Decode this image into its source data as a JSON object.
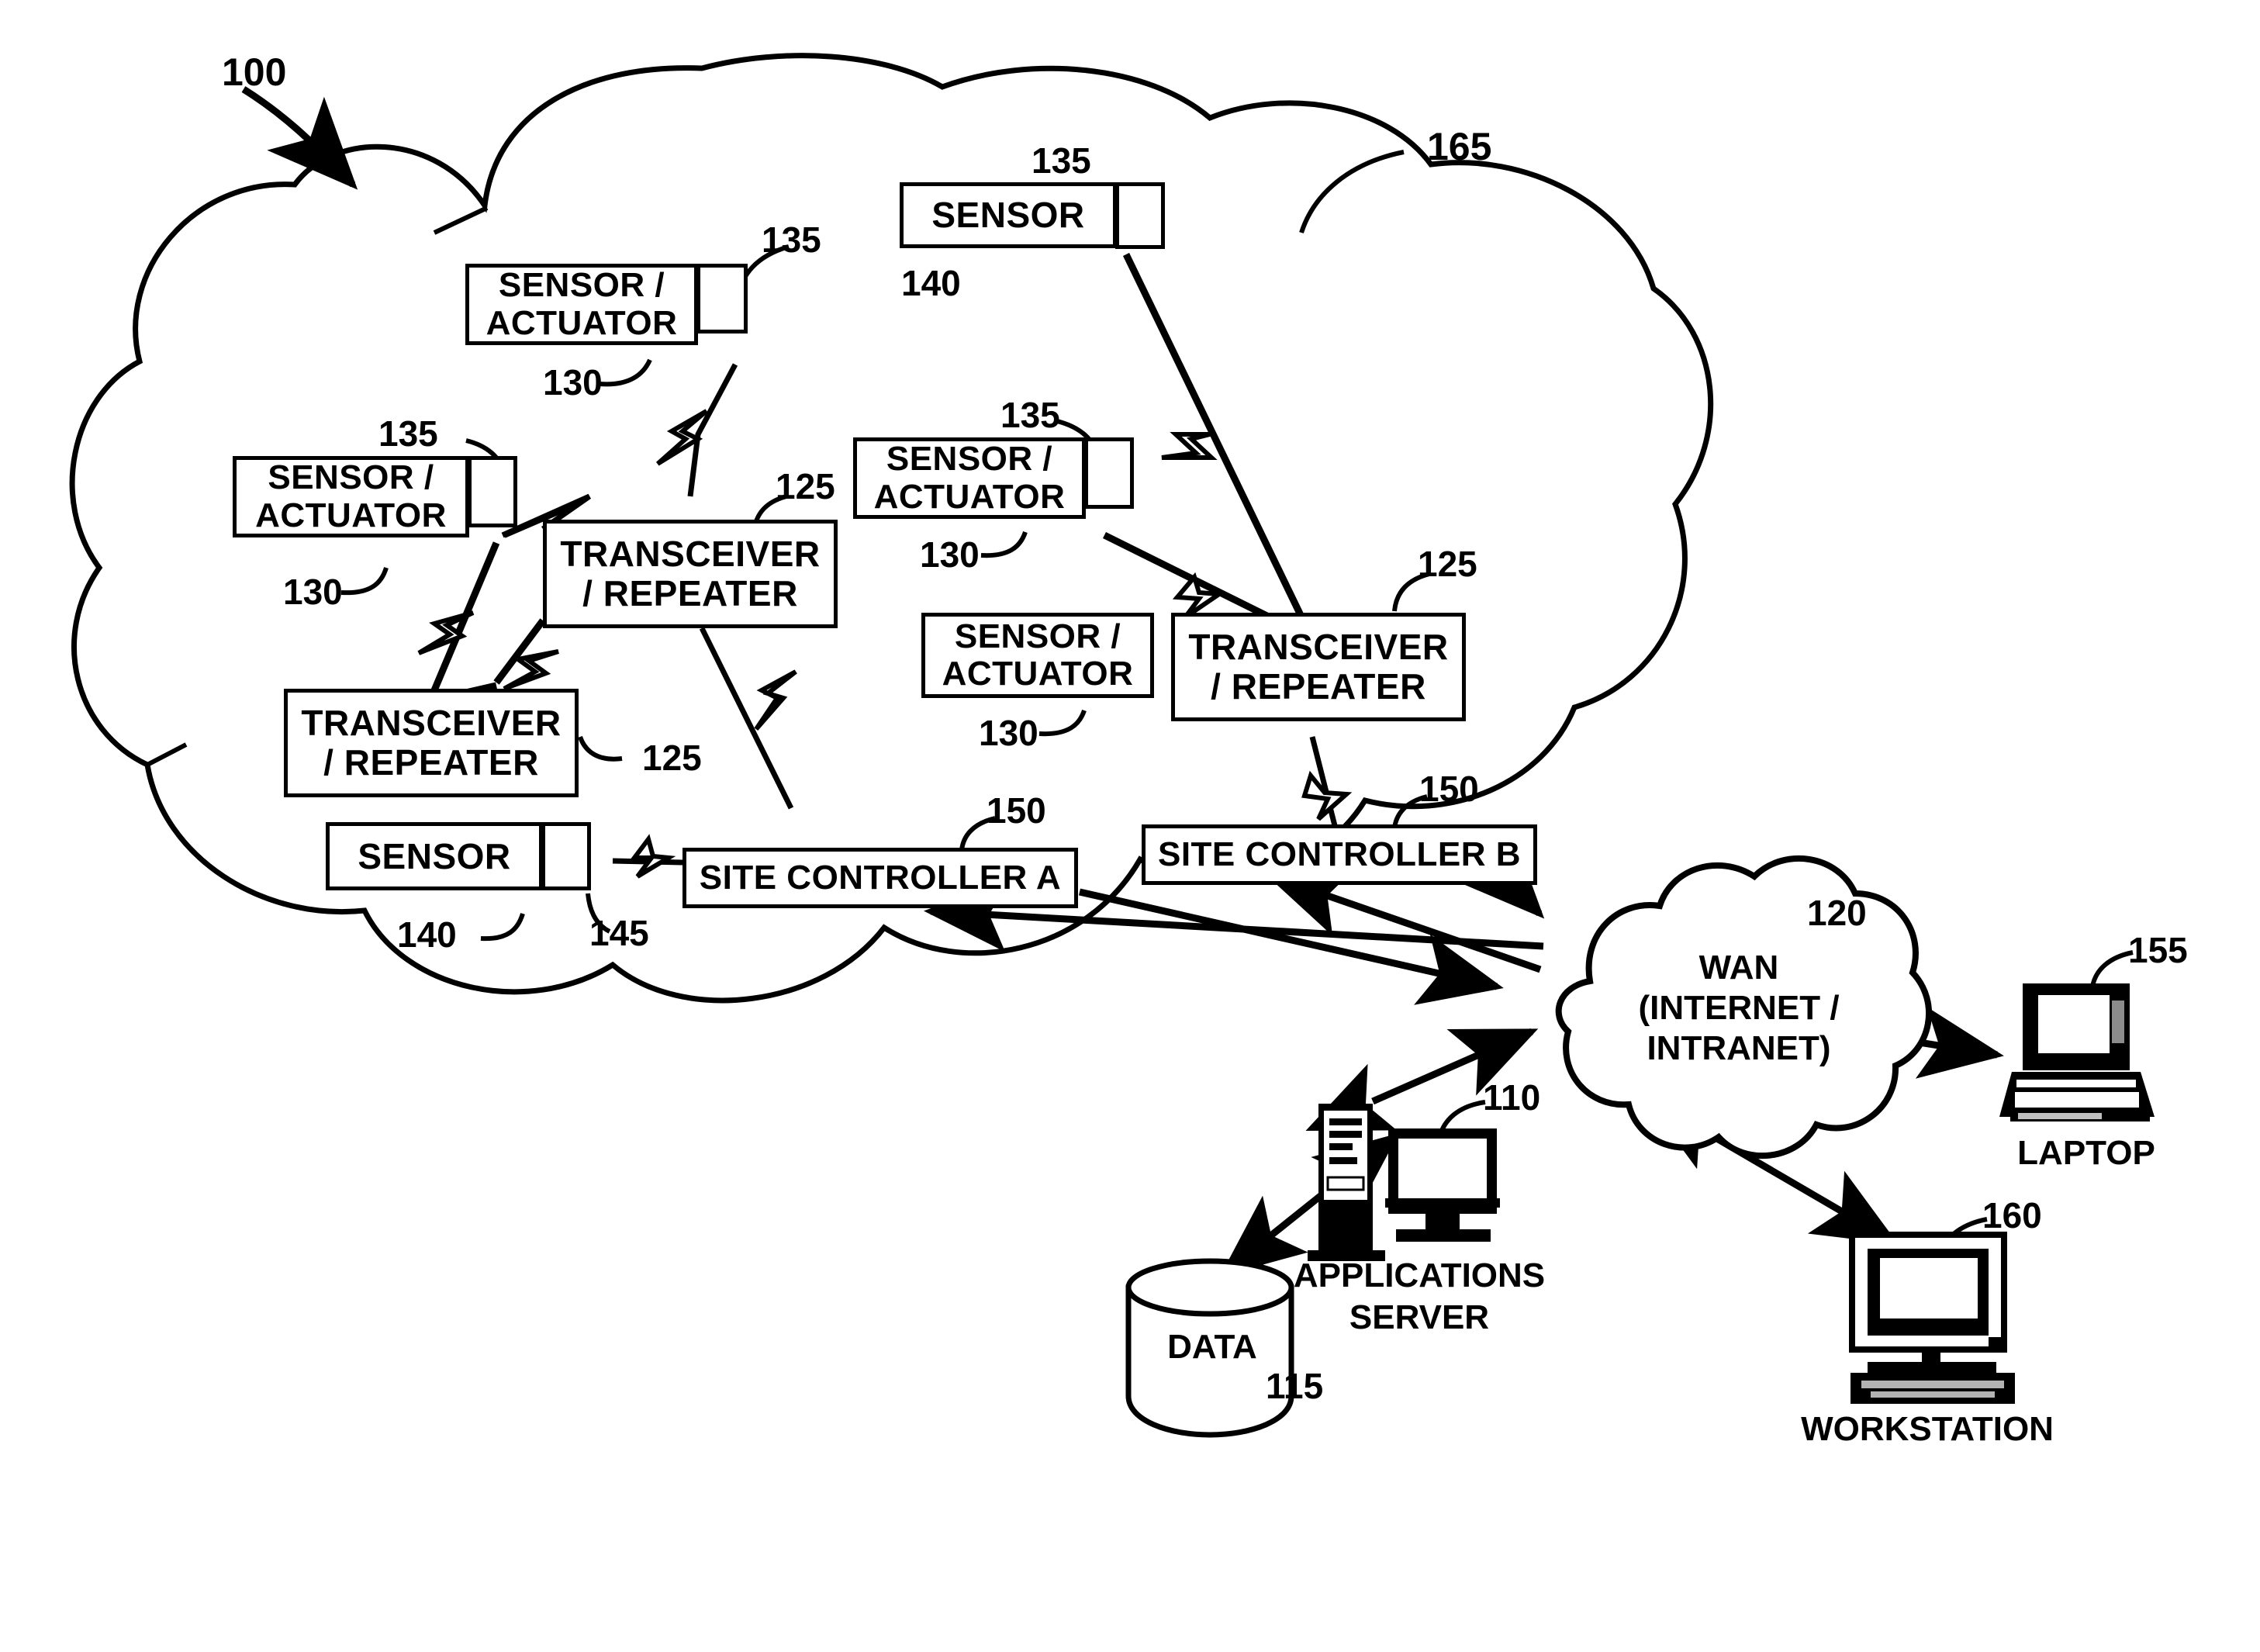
{
  "figure": {
    "type": "patent-network-diagram",
    "system_ref": "100",
    "site_cloud_ref": "165",
    "background": "#ffffff",
    "ink": "#000000"
  },
  "nodes": {
    "sensor_actuator_top": {
      "line1": "SENSOR /",
      "line2": "ACTUATOR",
      "ref_device": "130",
      "ref_antenna": "135"
    },
    "sensor_actuator_left": {
      "line1": "SENSOR /",
      "line2": "ACTUATOR",
      "ref_device": "130",
      "ref_antenna": "135"
    },
    "sensor_actuator_mid": {
      "line1": "SENSOR /",
      "line2": "ACTUATOR",
      "ref_device": "130",
      "ref_antenna": "135"
    },
    "sensor_actuator_lower_mid": {
      "line1": "SENSOR /",
      "line2": "ACTUATOR",
      "ref_device": "130"
    },
    "sensor_top": {
      "line1": "SENSOR",
      "ref_device": "140",
      "ref_antenna": "135"
    },
    "sensor_bottom": {
      "line1": "SENSOR",
      "ref_device": "140",
      "ref_module": "145"
    },
    "transceiver_left": {
      "line1": "TRANSCEIVER",
      "line2": "/ REPEATER",
      "ref": "125"
    },
    "transceiver_lower_left": {
      "line1": "TRANSCEIVER",
      "line2": "/ REPEATER",
      "ref": "125"
    },
    "transceiver_right": {
      "line1": "TRANSCEIVER",
      "line2": "/ REPEATER",
      "ref": "125"
    },
    "site_controller_a": {
      "label": "SITE CONTROLLER A",
      "ref": "150"
    },
    "site_controller_b": {
      "label": "SITE CONTROLLER B",
      "ref": "150"
    },
    "wan": {
      "line1": "WAN",
      "line2": "(INTERNET /",
      "line3": "INTRANET)",
      "ref": "120"
    },
    "applications_server": {
      "line1": "APPLICATIONS",
      "line2": "SERVER",
      "ref": "110"
    },
    "data_store": {
      "label": "DATA",
      "ref": "115"
    },
    "laptop": {
      "label": "LAPTOP",
      "ref": "155"
    },
    "workstation": {
      "label": "WORKSTATION",
      "ref": "160"
    }
  },
  "refs": {
    "system": "100",
    "site_cloud": "165",
    "transceiver": "125",
    "sensor_actuator": "130",
    "antenna": "135",
    "sensor": "140",
    "sensor_module": "145",
    "site_controller": "150",
    "wan": "120",
    "app_server": "110",
    "data": "115",
    "laptop": "155",
    "workstation": "160"
  },
  "links": {
    "wireless_symbol": "lightning-bolt",
    "wired_symbol": "arrow-line",
    "notes": [
      "Sensors and actuators link wirelessly to transceiver/repeaters",
      "Transceiver/repeaters link wirelessly to site controllers",
      "Site controllers link to WAN",
      "WAN links to applications server, laptop and workstation",
      "Applications server links to DATA store"
    ]
  }
}
